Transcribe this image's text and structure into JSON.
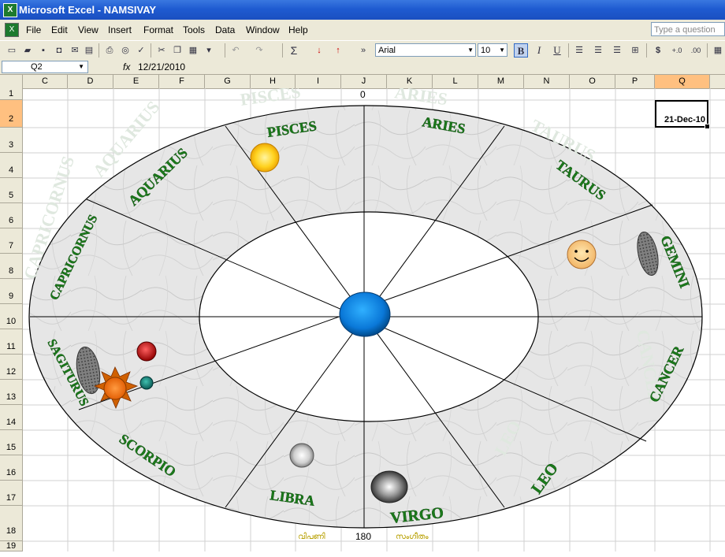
{
  "window": {
    "title": "Microsoft Excel - NAMSIVAY",
    "app_icon": "X"
  },
  "menu": {
    "items": [
      "File",
      "Edit",
      "View",
      "Insert",
      "Format",
      "Tools",
      "Data",
      "Window",
      "Help"
    ],
    "help_placeholder": "Type a question for"
  },
  "toolbar": {
    "font_name": "Arial",
    "font_size": "10",
    "bold": "B",
    "italic": "I",
    "underline": "U",
    "sum": "Σ",
    "currency": "$"
  },
  "formula_bar": {
    "name_box": "Q2",
    "fx": "fx",
    "formula": "12/21/2010"
  },
  "columns": [
    "C",
    "D",
    "E",
    "F",
    "G",
    "H",
    "I",
    "J",
    "K",
    "L",
    "M",
    "N",
    "O",
    "P",
    "Q"
  ],
  "rows": [
    "1",
    "2",
    "3",
    "4",
    "5",
    "6",
    "7",
    "8",
    "9",
    "10",
    "11",
    "12",
    "13",
    "14",
    "15",
    "16",
    "17",
    "18",
    "19"
  ],
  "cells": {
    "j1": "0",
    "q2": "21-Dec-10",
    "j18": "180",
    "i18": "വിപണി",
    "k18": "സംഗീതം"
  },
  "signs": [
    "PISCES",
    "ARIES",
    "TAURUS",
    "GEMINI",
    "CANCER",
    "LEO",
    "VIRGO",
    "LIBRA",
    "SCORPIO",
    "SAGITURUS",
    "CAPRICORNUS",
    "AQUARIUS"
  ],
  "colors": {
    "sign_text": "#1b7a1b",
    "title_bar": "#1f5bd1",
    "selected_column": "#ffc080"
  }
}
